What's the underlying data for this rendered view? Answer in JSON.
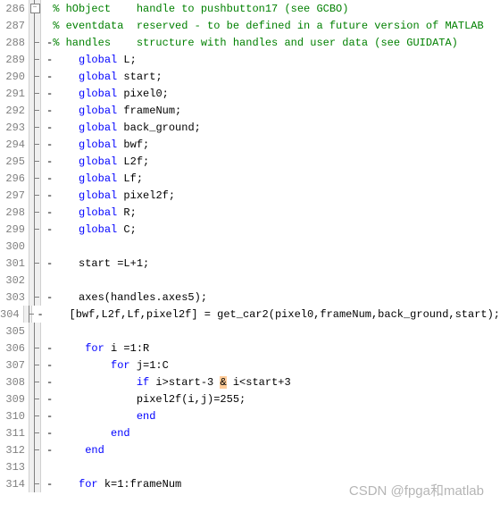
{
  "watermark": "CSDN @fpga和matlab",
  "lines": [
    {
      "num": 286,
      "fold": "box",
      "tokens": [
        [
          " ",
          "text"
        ],
        [
          "% hObject    handle to pushbutton17 (see GCBO)",
          "comment"
        ]
      ]
    },
    {
      "num": 287,
      "fold": "line",
      "tokens": [
        [
          " ",
          "text"
        ],
        [
          "% eventdata  reserved - to be defined in a future version of MATLAB",
          "comment"
        ]
      ]
    },
    {
      "num": 288,
      "fold": "dash",
      "tokens": [
        [
          "-",
          "text"
        ],
        [
          "% handles    structure with handles and user data (see GUIDATA)",
          "comment"
        ]
      ]
    },
    {
      "num": 289,
      "fold": "dash",
      "tokens": [
        [
          "-    ",
          "text"
        ],
        [
          "global",
          "keyword"
        ],
        [
          " L;",
          "text"
        ]
      ]
    },
    {
      "num": 290,
      "fold": "dash",
      "tokens": [
        [
          "-    ",
          "text"
        ],
        [
          "global",
          "keyword"
        ],
        [
          " start;",
          "text"
        ]
      ]
    },
    {
      "num": 291,
      "fold": "dash",
      "tokens": [
        [
          "-    ",
          "text"
        ],
        [
          "global",
          "keyword"
        ],
        [
          " pixel0;",
          "text"
        ]
      ]
    },
    {
      "num": 292,
      "fold": "dash",
      "tokens": [
        [
          "-    ",
          "text"
        ],
        [
          "global",
          "keyword"
        ],
        [
          " frameNum;",
          "text"
        ]
      ]
    },
    {
      "num": 293,
      "fold": "dash",
      "tokens": [
        [
          "-    ",
          "text"
        ],
        [
          "global",
          "keyword"
        ],
        [
          " back_ground;",
          "text"
        ]
      ]
    },
    {
      "num": 294,
      "fold": "dash",
      "tokens": [
        [
          "-    ",
          "text"
        ],
        [
          "global",
          "keyword"
        ],
        [
          " bwf;",
          "text"
        ]
      ]
    },
    {
      "num": 295,
      "fold": "dash",
      "tokens": [
        [
          "-    ",
          "text"
        ],
        [
          "global",
          "keyword"
        ],
        [
          " L2f;",
          "text"
        ]
      ]
    },
    {
      "num": 296,
      "fold": "dash",
      "tokens": [
        [
          "-    ",
          "text"
        ],
        [
          "global",
          "keyword"
        ],
        [
          " Lf;",
          "text"
        ]
      ]
    },
    {
      "num": 297,
      "fold": "dash",
      "tokens": [
        [
          "-    ",
          "text"
        ],
        [
          "global",
          "keyword"
        ],
        [
          " pixel2f;",
          "text"
        ]
      ]
    },
    {
      "num": 298,
      "fold": "dash",
      "tokens": [
        [
          "-    ",
          "text"
        ],
        [
          "global",
          "keyword"
        ],
        [
          " R;",
          "text"
        ]
      ]
    },
    {
      "num": 299,
      "fold": "dash",
      "tokens": [
        [
          "-    ",
          "text"
        ],
        [
          "global",
          "keyword"
        ],
        [
          " C;",
          "text"
        ]
      ]
    },
    {
      "num": 300,
      "fold": "line",
      "tokens": [
        [
          " ",
          "text"
        ]
      ]
    },
    {
      "num": 301,
      "fold": "dash",
      "tokens": [
        [
          "-    start =L+1;",
          "text"
        ]
      ]
    },
    {
      "num": 302,
      "fold": "line",
      "tokens": [
        [
          " ",
          "text"
        ]
      ]
    },
    {
      "num": 303,
      "fold": "dash",
      "tokens": [
        [
          "-    axes(handles.axes5);",
          "text"
        ]
      ]
    },
    {
      "num": 304,
      "fold": "dash",
      "tokens": [
        [
          "-    [bwf,L2f,Lf,pixel2f] = get_car2(pixel0,frameNum,back_ground,start);",
          "text"
        ]
      ]
    },
    {
      "num": 305,
      "fold": "line",
      "tokens": [
        [
          " ",
          "text"
        ]
      ]
    },
    {
      "num": 306,
      "fold": "dash",
      "tokens": [
        [
          "-     ",
          "text"
        ],
        [
          "for",
          "keyword"
        ],
        [
          " i =1:R",
          "text"
        ]
      ]
    },
    {
      "num": 307,
      "fold": "dash",
      "tokens": [
        [
          "-         ",
          "text"
        ],
        [
          "for",
          "keyword"
        ],
        [
          " j=1:C",
          "text"
        ]
      ]
    },
    {
      "num": 308,
      "fold": "dash",
      "tokens": [
        [
          "-             ",
          "text"
        ],
        [
          "if",
          "keyword"
        ],
        [
          " i>start-3 ",
          "text"
        ],
        [
          "&",
          "highlight"
        ],
        [
          " i<start+3",
          "text"
        ]
      ]
    },
    {
      "num": 309,
      "fold": "dash",
      "tokens": [
        [
          "-             pixel2f(i,j)=255;",
          "text"
        ]
      ]
    },
    {
      "num": 310,
      "fold": "dash",
      "tokens": [
        [
          "-             ",
          "text"
        ],
        [
          "end",
          "keyword"
        ]
      ]
    },
    {
      "num": 311,
      "fold": "dash",
      "tokens": [
        [
          "-         ",
          "text"
        ],
        [
          "end",
          "keyword"
        ]
      ]
    },
    {
      "num": 312,
      "fold": "dash",
      "tokens": [
        [
          "-     ",
          "text"
        ],
        [
          "end",
          "keyword"
        ]
      ]
    },
    {
      "num": 313,
      "fold": "line",
      "tokens": [
        [
          " ",
          "text"
        ]
      ]
    },
    {
      "num": 314,
      "fold": "dash",
      "tokens": [
        [
          "-    ",
          "text"
        ],
        [
          "for",
          "keyword"
        ],
        [
          " k=1:frameNum",
          "text"
        ]
      ]
    }
  ]
}
